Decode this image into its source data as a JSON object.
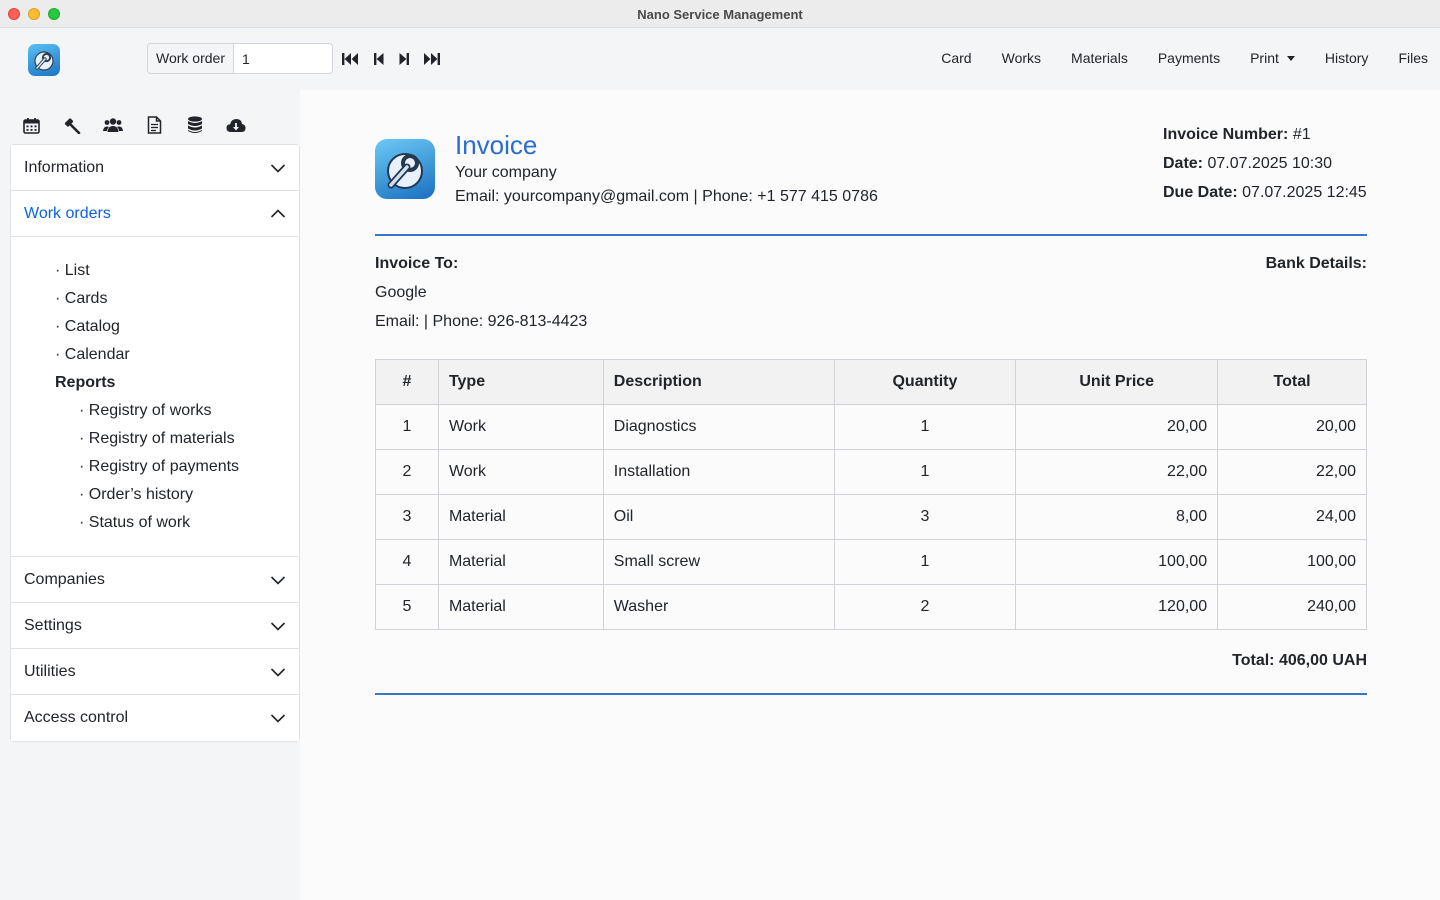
{
  "window": {
    "title": "Nano Service Management"
  },
  "toolbar": {
    "record_label": "Work order",
    "record_value": "1",
    "menu": [
      "Card",
      "Works",
      "Materials",
      "Payments",
      "Print",
      "History",
      "Files"
    ]
  },
  "sidebar": {
    "icons": [
      "calendar-icon",
      "gavel-icon",
      "users-icon",
      "document-icon",
      "database-icon",
      "cloud-download-icon"
    ],
    "sections": {
      "information": "Information",
      "work_orders": "Work orders",
      "companies": "Companies",
      "settings": "Settings",
      "utilities": "Utilities",
      "access_control": "Access control"
    },
    "work_order_items": [
      "· List",
      "· Cards",
      "· Catalog",
      "· Calendar"
    ],
    "reports_heading": "Reports",
    "report_items": [
      "· Registry of works",
      "· Registry of materials",
      "· Registry of payments",
      "· Order’s history",
      "· Status of work"
    ]
  },
  "invoice": {
    "title": "Invoice",
    "company": "Your company",
    "contact": "Email: yourcompany@gmail.com | Phone: +1 577 415 0786",
    "number_label": "Invoice Number:",
    "number_value": "#1",
    "date_label": "Date:",
    "date_value": "07.07.2025 10:30",
    "due_label": "Due Date:",
    "due_value": "07.07.2025 12:45",
    "to_label": "Invoice To:",
    "bank_label": "Bank Details:",
    "client": "Google",
    "client_contact": "Email: | Phone: 926-813-4423",
    "columns": [
      "#",
      "Type",
      "Description",
      "Quantity",
      "Unit Price",
      "Total"
    ],
    "rows": [
      [
        "1",
        "Work",
        "Diagnostics",
        "1",
        "20,00",
        "20,00"
      ],
      [
        "2",
        "Work",
        "Installation",
        "1",
        "22,00",
        "22,00"
      ],
      [
        "3",
        "Material",
        "Oil",
        "3",
        "8,00",
        "24,00"
      ],
      [
        "4",
        "Material",
        "Small screw",
        "1",
        "100,00",
        "100,00"
      ],
      [
        "5",
        "Material",
        "Washer",
        "2",
        "120,00",
        "240,00"
      ]
    ],
    "grand_total": "Total: 406,00 UAH"
  },
  "colors": {
    "accent": "#2a6cd4",
    "divider": "#3a75c9"
  }
}
